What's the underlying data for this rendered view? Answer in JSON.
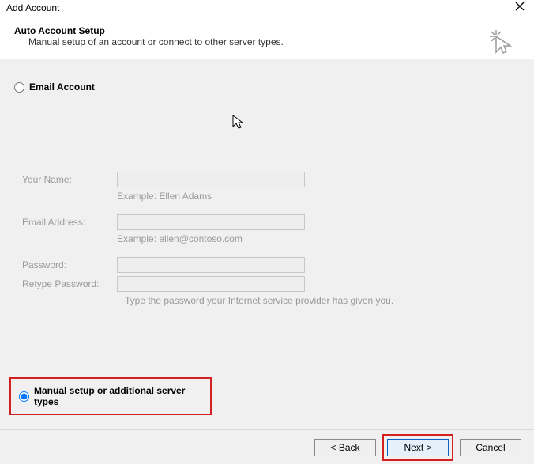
{
  "window": {
    "title": "Add Account"
  },
  "header": {
    "heading": "Auto Account Setup",
    "subheading": "Manual setup of an account or connect to other server types."
  },
  "options": {
    "email_account_label": "Email Account",
    "manual_setup_label": "Manual setup or additional server types"
  },
  "form": {
    "your_name_label": "Your Name:",
    "your_name_hint": "Example: Ellen Adams",
    "email_label": "Email Address:",
    "email_hint": "Example: ellen@contoso.com",
    "password_label": "Password:",
    "retype_password_label": "Retype Password:",
    "password_hint": "Type the password your Internet service provider has given you."
  },
  "buttons": {
    "back": "< Back",
    "next": "Next >",
    "cancel": "Cancel"
  }
}
